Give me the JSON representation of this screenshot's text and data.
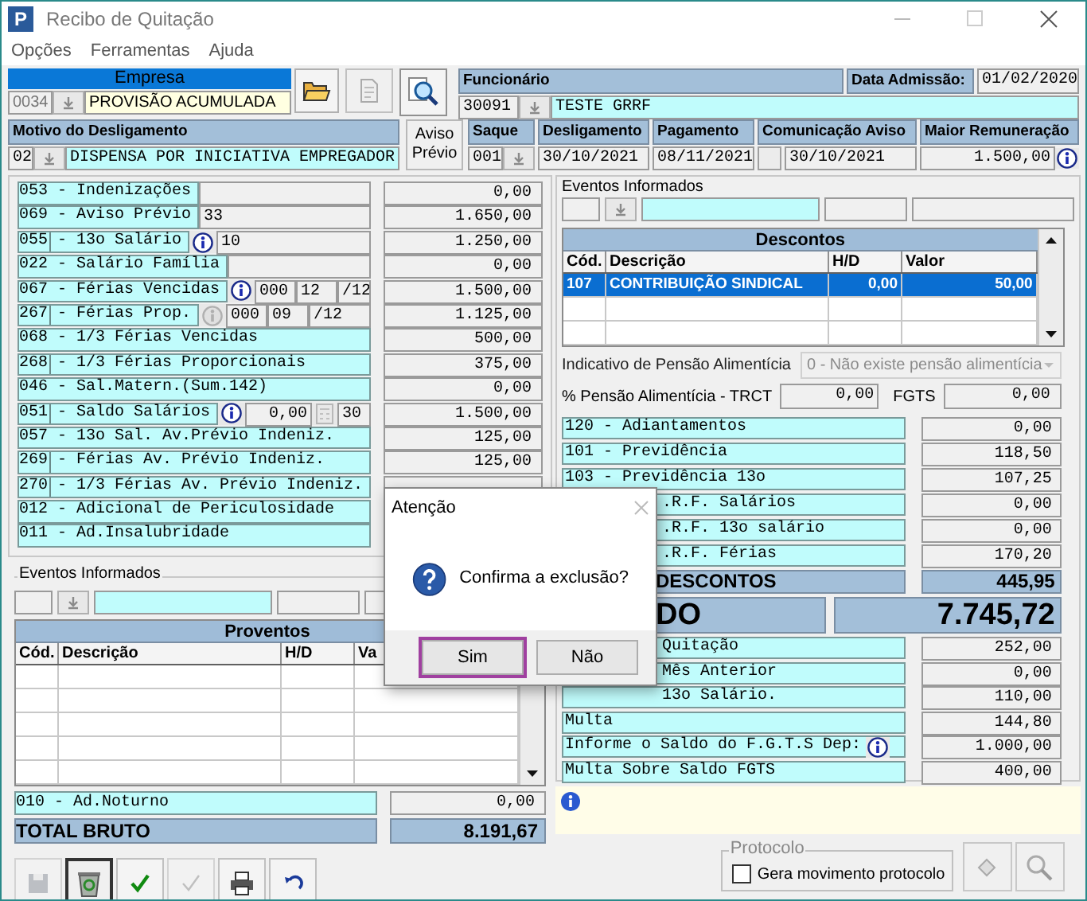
{
  "window": {
    "logo_letter": "P",
    "title": "Recibo de Quitação"
  },
  "menu": [
    "Opções",
    "Ferramentas",
    "Ajuda"
  ],
  "empresa": {
    "label": "Empresa",
    "code": "0034",
    "name": "PROVISÃO ACUMULADA"
  },
  "funcionario": {
    "label": "Funcionário",
    "code": "30091",
    "name": "TESTE GRRF",
    "admission_label": "Data Admissão:",
    "admission": "01/02/2020"
  },
  "motivo": {
    "label": "Motivo do Desligamento",
    "code": "02",
    "text": "DISPENSA POR INICIATIVA EMPREGADOR"
  },
  "aviso_previo_button": "Aviso Prévio",
  "saque": {
    "label": "Saque",
    "code": "001"
  },
  "desligamento": {
    "label": "Desligamento",
    "date": "30/10/2021"
  },
  "pagamento": {
    "label": "Pagamento",
    "date": "08/11/2021"
  },
  "comunicacao": {
    "label": "Comunicação Aviso",
    "checked": false,
    "date": "30/10/2021"
  },
  "maior_remuneracao": {
    "label": "Maior Remuneração",
    "value": "1.500,00"
  },
  "proventos_rows": [
    {
      "code": "053",
      "label": "- Indenizações",
      "boxed": false,
      "parts": [
        {
          "kind": "field"
        }
      ],
      "value": "0,00"
    },
    {
      "code": "069",
      "label": "- Aviso Prévio",
      "boxed": false,
      "parts": [
        {
          "kind": "field",
          "text": "33"
        }
      ],
      "value": "1.650,00"
    },
    {
      "code": "055",
      "label": "- 13o Salário",
      "boxed": true,
      "parts": [
        {
          "kind": "info"
        },
        {
          "kind": "field",
          "text": "10"
        }
      ],
      "value": "1.250,00"
    },
    {
      "code": "022",
      "label": "- Salário Família",
      "boxed": false,
      "parts": [
        {
          "kind": "field"
        }
      ],
      "value": "0,00"
    },
    {
      "code": "067",
      "label": "- Férias Vencidas",
      "boxed": false,
      "parts": [
        {
          "kind": "info"
        },
        {
          "kind": "field",
          "text": "000"
        },
        {
          "kind": "field",
          "text": "12"
        },
        {
          "kind": "field",
          "text": "/12"
        }
      ],
      "value": "1.500,00"
    },
    {
      "code": "267",
      "label": "- Férias Prop.",
      "boxed": true,
      "parts": [
        {
          "kind": "info-off"
        },
        {
          "kind": "field",
          "text": "000"
        },
        {
          "kind": "field",
          "text": "09"
        },
        {
          "kind": "field",
          "text": "/12"
        }
      ],
      "value": "1.125,00"
    },
    {
      "code": "068",
      "label": "- 1/3 Férias Vencidas",
      "boxed": false,
      "value": "500,00"
    },
    {
      "code": "268",
      "label": "- 1/3 Férias Proporcionais",
      "boxed": true,
      "value": "375,00"
    },
    {
      "code": "046",
      "label": "- Sal.Matern.(Sum.142)",
      "boxed": false,
      "value": "0,00"
    },
    {
      "code": "051",
      "label": "- Saldo Salários",
      "boxed": true,
      "parts": [
        {
          "kind": "info"
        },
        {
          "kind": "amount",
          "text": "0,00"
        },
        {
          "kind": "calc-off"
        },
        {
          "kind": "field",
          "text": "30"
        }
      ],
      "value": "1.500,00"
    },
    {
      "code": "057",
      "label": "- 13o Sal. Av.Prévio Indeniz.",
      "boxed": false,
      "value": "125,00"
    },
    {
      "code": "269",
      "label": "- Férias  Av. Prévio Indeniz.",
      "boxed": true,
      "value": "125,00"
    },
    {
      "code": "270",
      "label": "- 1/3 Férias Av. Prévio Indeniz.",
      "boxed": true
    },
    {
      "code": "012",
      "label": "- Adicional de Periculosidade",
      "boxed": false
    },
    {
      "code": "011",
      "label": "- Ad.Insalubridade",
      "boxed": false
    }
  ],
  "eventos_left": {
    "label": "Eventos Informados"
  },
  "proventos_table": {
    "title": "Proventos",
    "columns": [
      "Cód.",
      "Descrição",
      "H/D",
      "Va"
    ]
  },
  "adicional_noturno": {
    "label": "010 - Ad.Noturno",
    "value": "0,00"
  },
  "total_bruto": {
    "label": "TOTAL BRUTO",
    "value": "8.191,67"
  },
  "toolbar": [
    {
      "kind": "save",
      "disabled": true,
      "selected": false
    },
    {
      "kind": "recycle",
      "disabled": false,
      "selected": true
    },
    {
      "kind": "check",
      "disabled": false,
      "selected": false
    },
    {
      "kind": "check",
      "disabled": true,
      "selected": false
    },
    {
      "kind": "print",
      "disabled": false,
      "selected": false
    },
    {
      "kind": "undo",
      "disabled": false,
      "selected": false
    }
  ],
  "eventos_right": {
    "label": "Eventos Informados"
  },
  "descontos_table": {
    "title": "Descontos",
    "columns": [
      "Cód.",
      "Descrição",
      "H/D",
      "Valor"
    ],
    "rows": [
      {
        "cells": [
          "107",
          "CONTRIBUIÇÃO SINDICAL",
          "0,00",
          "50,00"
        ],
        "selected": true
      }
    ]
  },
  "pensao": {
    "label": "Indicativo de Pensão Alimentícia",
    "value": "0 - Não existe pensão alimentícia",
    "disabled": true
  },
  "pensao_trct": {
    "label": "% Pensão Alimentícia - TRCT",
    "value": "0,00",
    "fgts_label": "FGTS",
    "fgts_value": "0,00"
  },
  "descontos_rows": [
    {
      "kind": "full",
      "label": "120 - Adiantamentos",
      "value": "0,00"
    },
    {
      "kind": "full",
      "label": "101 - Previdência",
      "value": "118,50"
    },
    {
      "kind": "full",
      "label": "103 - Previdência 13o",
      "value": "107,25"
    },
    {
      "kind": "partial",
      "label": ".R.F. Salários",
      "value": "0,00"
    },
    {
      "kind": "partial",
      "label": ".R.F. 13o salário",
      "value": "0,00"
    },
    {
      "kind": "partial",
      "label": ".R.F. Férias",
      "value": "170,20"
    }
  ],
  "total_descontos": {
    "label": "DESCONTOS",
    "value": "445,95"
  },
  "liquido": {
    "label": "DO",
    "value": "7.745,72"
  },
  "fgts_rows": [
    {
      "kind": "partial",
      "label": "Quitação",
      "value": "252,00",
      "info": false
    },
    {
      "kind": "partial",
      "label": "Mês Anterior",
      "value": "0,00",
      "info": false
    },
    {
      "kind": "partial",
      "label": "13o Salário.",
      "value": "110,00",
      "info": false
    },
    {
      "kind": "full",
      "label": "Multa",
      "value": "144,80",
      "info": false
    },
    {
      "kind": "full",
      "label": "Informe o Saldo do F.G.T.S Dep:",
      "value": "1.000,00",
      "info": true
    },
    {
      "kind": "full",
      "label": "Multa Sobre Saldo FGTS",
      "value": "400,00",
      "info": false
    }
  ],
  "protocolo": {
    "label": "Protocolo",
    "checkbox_label": "Gera movimento protocolo",
    "checked": false
  },
  "dialog": {
    "title": "Atenção",
    "message": "Confirma a exclusão?",
    "buttons": [
      {
        "label": "Sim",
        "selected": true
      },
      {
        "label": "Não",
        "selected": false
      }
    ]
  }
}
